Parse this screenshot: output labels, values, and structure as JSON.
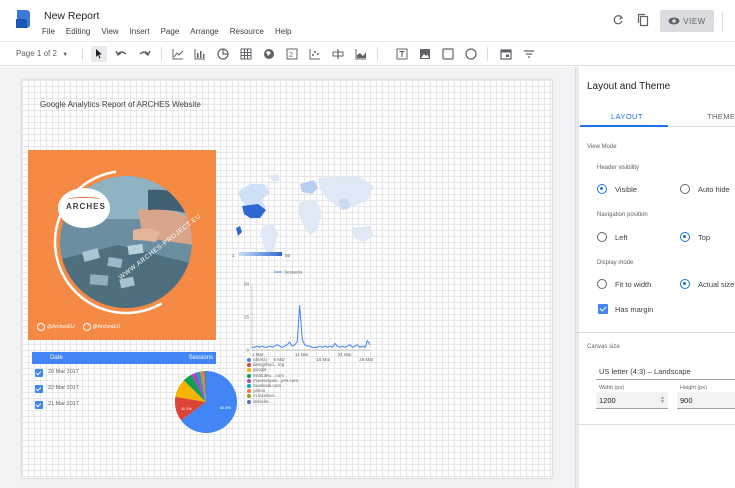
{
  "app": {
    "title": "New Report",
    "menu": [
      "File",
      "Editing",
      "View",
      "Insert",
      "Page",
      "Arrange",
      "Resource",
      "Help"
    ],
    "view_label": "VIEW"
  },
  "toolbar": {
    "page_selector": "Page 1 of 2"
  },
  "report": {
    "title": "Google Analytics Report of ARCHES Website",
    "promo": {
      "logo_text": "ARCHES",
      "url_text": "WWW.ARCHES-PROJECT.EU",
      "social": [
        "@ArchesEU",
        "@ArchesEU"
      ]
    },
    "geo_map": {
      "scale_min": "1",
      "scale_max": "56"
    },
    "timeseries": {
      "legend": "Sessions"
    },
    "table": {
      "headers": [
        "Date",
        "Sessions"
      ],
      "rows": [
        "20 Mar 2017",
        "22 Mar 2017",
        "21 Mar 2017"
      ]
    },
    "pie": {
      "legend": [
        "(direct)",
        "designboo…ing",
        "google",
        "instituteu…com",
        "museumpra…ject.com",
        "facebook.com",
        "yahoo",
        "m.faceboo…",
        "linkedin…"
      ],
      "colors": [
        "#4285f4",
        "#db4437",
        "#f4b400",
        "#0f9d58",
        "#ab47bc",
        "#00acc1",
        "#ff7043",
        "#9e9d24",
        "#5c6bc0"
      ],
      "labels": [
        "60.5%",
        "11.1%"
      ]
    }
  },
  "chart_data": {
    "type": "line",
    "series": [
      {
        "name": "Sessions",
        "values": [
          2,
          2,
          3,
          2,
          3,
          2,
          2,
          3,
          2,
          3,
          4,
          3,
          2,
          3,
          4,
          6,
          3,
          4,
          6,
          34,
          8,
          4,
          3,
          3,
          2,
          2,
          2,
          3,
          2,
          3,
          2,
          3,
          2,
          5,
          3,
          2,
          3,
          2,
          3,
          4,
          2,
          3,
          4,
          2,
          3,
          2,
          7,
          4
        ]
      }
    ],
    "x_tick_labels": [
      "1 Mar",
      "6 Mar",
      "11 Mar",
      "16 Mar",
      "21 Mar",
      "26 Mar"
    ],
    "y_tick_labels": [
      "50",
      "25",
      "0"
    ],
    "ylim": [
      0,
      50
    ]
  },
  "panel": {
    "title": "Layout and Theme",
    "tabs": [
      "LAYOUT",
      "THEME"
    ],
    "view_mode": "View Mode",
    "header_visibility": "Header visibility",
    "visible": "Visible",
    "auto_hide": "Auto hide",
    "navigation_position": "Navigation position",
    "left": "Left",
    "top": "Top",
    "display_mode": "Display mode",
    "fit_to_width": "Fit to width",
    "actual_size": "Actual size",
    "has_margin": "Has margin",
    "canvas_size": "Canvas size",
    "canvas_preset": "US letter (4:3) – Landscape",
    "width_label": "Width (px)",
    "width_value": "1200",
    "height_label": "Height (px)",
    "height_value": "900"
  }
}
